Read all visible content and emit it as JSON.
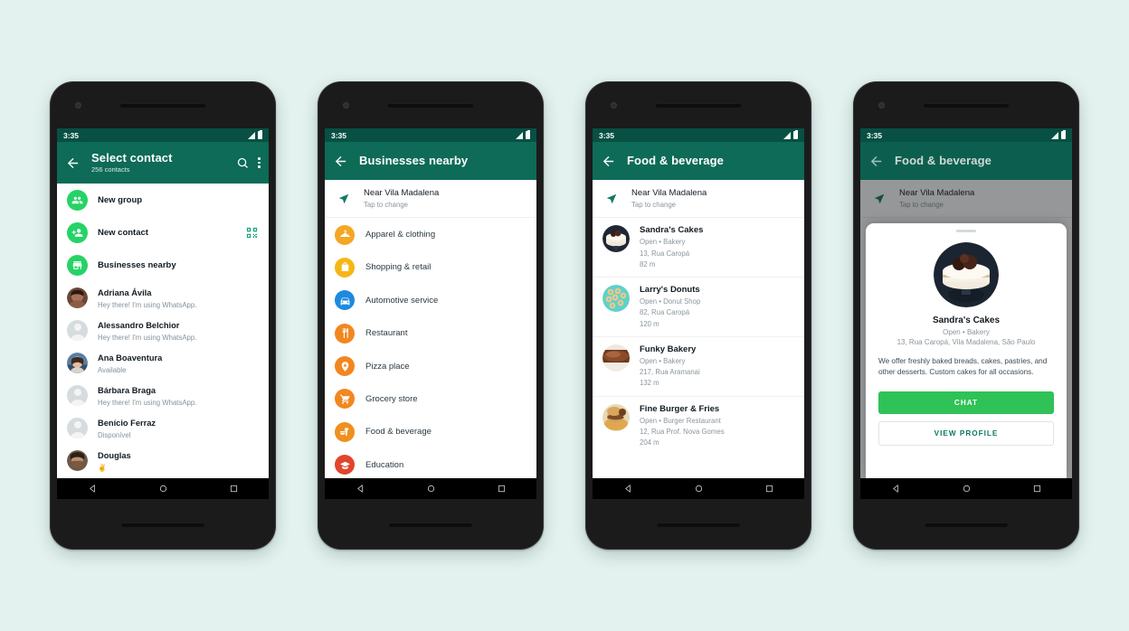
{
  "background_color": "#e3f2ef",
  "accent": {
    "header_green": "#0d6b57",
    "status_green": "#075043",
    "bright_green": "#25d366",
    "chat_button": "#2ec257",
    "link_teal": "#0e7a62"
  },
  "status_bar": {
    "time": "3:35",
    "signal_icon": "signal-icon",
    "battery_icon": "battery-icon"
  },
  "nav_bar": {
    "back": "back-triangle-icon",
    "home": "home-circle-icon",
    "recents": "recents-square-icon"
  },
  "phones": [
    {
      "id": "phone-select-contact",
      "appbar": {
        "back_icon": "back-arrow-icon",
        "title": "Select contact",
        "subtitle": "256 contacts",
        "search_icon": "search-icon",
        "overflow_icon": "overflow-menu-icon"
      },
      "actions": [
        {
          "icon": "new-group-icon",
          "label": "New group",
          "trailing": null
        },
        {
          "icon": "new-contact-icon",
          "label": "New contact",
          "trailing": "qr-code-icon"
        },
        {
          "icon": "businesses-nearby-icon",
          "label": "Businesses nearby",
          "trailing": null
        }
      ],
      "contacts": [
        {
          "name": "Adriana Ávila",
          "status": "Hey there! I'm using WhatsApp.",
          "avatar": "photo"
        },
        {
          "name": "Alessandro Belchior",
          "status": "Hey there! I'm using WhatsApp.",
          "avatar": "placeholder"
        },
        {
          "name": "Ana Boaventura",
          "status": "Available",
          "avatar": "photo"
        },
        {
          "name": "Bárbara Braga",
          "status": "Hey there! I'm using WhatsApp.",
          "avatar": "placeholder"
        },
        {
          "name": "Benício Ferraz",
          "status": "Disponível",
          "avatar": "placeholder"
        },
        {
          "name": "Douglas",
          "status": "✌️",
          "avatar": "photo"
        }
      ]
    },
    {
      "id": "phone-businesses-nearby",
      "appbar": {
        "back_icon": "back-arrow-icon",
        "title": "Businesses nearby"
      },
      "location": {
        "icon": "navigation-arrow-icon",
        "title": "Near Vila Madalena",
        "subtitle": "Tap to change"
      },
      "categories": [
        {
          "label": "Apparel & clothing",
          "icon": "hanger-icon",
          "color": "#f5a623"
        },
        {
          "label": "Shopping & retail",
          "icon": "shopping-bag-icon",
          "color": "#f5b617"
        },
        {
          "label": "Automotive service",
          "icon": "car-icon",
          "color": "#1d8ae0"
        },
        {
          "label": "Restaurant",
          "icon": "cutlery-icon",
          "color": "#f2871f"
        },
        {
          "label": "Pizza place",
          "icon": "pizza-pin-icon",
          "color": "#f2871f"
        },
        {
          "label": "Grocery store",
          "icon": "shopping-cart-icon",
          "color": "#f2871f"
        },
        {
          "label": "Food & beverage",
          "icon": "food-drink-icon",
          "color": "#f0901d"
        },
        {
          "label": "Education",
          "icon": "graduation-cap-icon",
          "color": "#e2452d"
        }
      ]
    },
    {
      "id": "phone-food-beverage-list",
      "appbar": {
        "back_icon": "back-arrow-icon",
        "title": "Food & beverage"
      },
      "location": {
        "icon": "navigation-arrow-icon",
        "title": "Near Vila Madalena",
        "subtitle": "Tap to change"
      },
      "businesses": [
        {
          "name": "Sandra's Cakes",
          "meta": "Open • Bakery",
          "address": "13, Rua Caropá",
          "distance": "82 m",
          "avatar": "cake"
        },
        {
          "name": "Larry's Donuts",
          "meta": "Open • Donut Shop",
          "address": "82, Rua Caropá",
          "distance": "120 m",
          "avatar": "donut"
        },
        {
          "name": "Funky Bakery",
          "meta": "Open • Bakery",
          "address": "217, Rua Aramanai",
          "distance": "132 m",
          "avatar": "bread"
        },
        {
          "name": "Fine Burger & Fries",
          "meta": "Open • Burger Restaurant",
          "address": "12, Rua Prof. Nova Gomes",
          "distance": "204 m",
          "avatar": "burger"
        }
      ]
    },
    {
      "id": "phone-business-profile-card",
      "appbar": {
        "back_icon": "back-arrow-icon",
        "title": "Food & beverage"
      },
      "location": {
        "icon": "navigation-arrow-icon",
        "title": "Near Vila Madalena",
        "subtitle": "Tap to change"
      },
      "card": {
        "grab_handle": "drag-handle",
        "avatar": "cake",
        "name": "Sandra's Cakes",
        "meta": "Open • Bakery",
        "address": "13, Rua Caropá, Vila Madalena, São Paulo",
        "description": "We offer freshly baked breads, cakes, pastries, and other desserts. Custom cakes for all occasions.",
        "chat_button": "CHAT",
        "profile_button": "VIEW PROFILE"
      }
    }
  ]
}
